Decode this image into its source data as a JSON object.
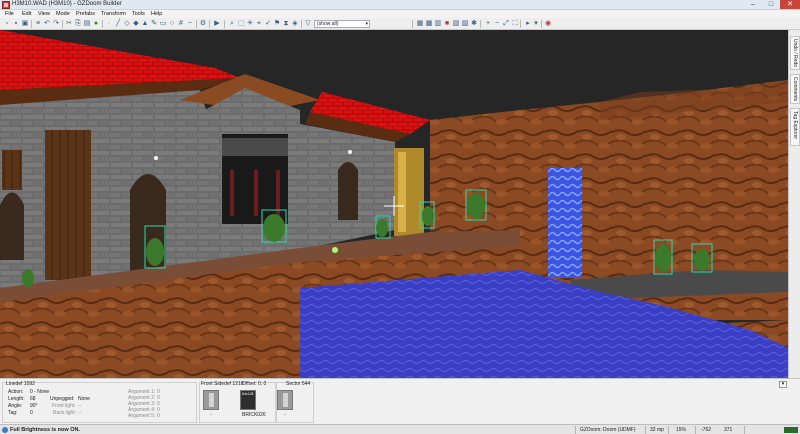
{
  "window": {
    "title": "H3M10.WAD (H3M10) - GZDoom Builder",
    "minimize": "–",
    "maximize": "□",
    "close": "✕"
  },
  "menu": [
    "File",
    "Edit",
    "View",
    "Mode",
    "Prefabs",
    "Transform",
    "Tools",
    "Help"
  ],
  "toolbar": {
    "filter_value": "(show all)",
    "filter_chevron": "▾"
  },
  "side_tabs": [
    "Undo / Redo",
    "Comments",
    "Tag Explorer"
  ],
  "linedef": {
    "heading": "Linedef 1092",
    "rows": [
      {
        "label": "Action:",
        "value": "0 - None"
      },
      {
        "label": "Length:",
        "value": "68"
      },
      {
        "label": "Angle:",
        "value": "90°"
      },
      {
        "label": "Tag:",
        "value": "0"
      }
    ],
    "unpegged_label": "Unpegged:",
    "unpegged_value": "None",
    "frontlight_label": "Front light:",
    "frontlight_value": "--",
    "backlight_label": "Back light:",
    "backlight_value": "--",
    "arguments": [
      {
        "label": "Argument 1:",
        "value": "0"
      },
      {
        "label": "Argument 2:",
        "value": "0"
      },
      {
        "label": "Argument 3:",
        "value": "0"
      },
      {
        "label": "Argument 4:",
        "value": "0"
      },
      {
        "label": "Argument 5:",
        "value": "0"
      }
    ]
  },
  "front_side": {
    "heading": "Front Sidedef 1218",
    "offset_label": "Offset:",
    "offset_value": "0, 0",
    "textures": [
      {
        "caption": "-",
        "size": ""
      },
      {
        "caption": "BRICK026",
        "size": "64x128"
      },
      {
        "caption": "-",
        "size": ""
      }
    ]
  },
  "sector": {
    "heading": "Sector 544",
    "textures": [
      {
        "caption": "-"
      }
    ]
  },
  "collapse_label": "▾",
  "status": {
    "message": "Full Brightness is now ON.",
    "engine": "GZDoom: Doom (UDMF)",
    "grid": "32 mp",
    "zoom": "15%",
    "coord_x": "-762",
    "coord_y": "371"
  },
  "colors": {
    "roof": "#e01010",
    "stone_wall": "#6e6e6e",
    "rock": "#8b4a24",
    "water": "#3a3fc4",
    "waterfall": "#3a55e0",
    "thing_box": "#2fd8a8"
  },
  "icons": {
    "app": "gzdb-logo-icon",
    "status": "info-icon"
  }
}
